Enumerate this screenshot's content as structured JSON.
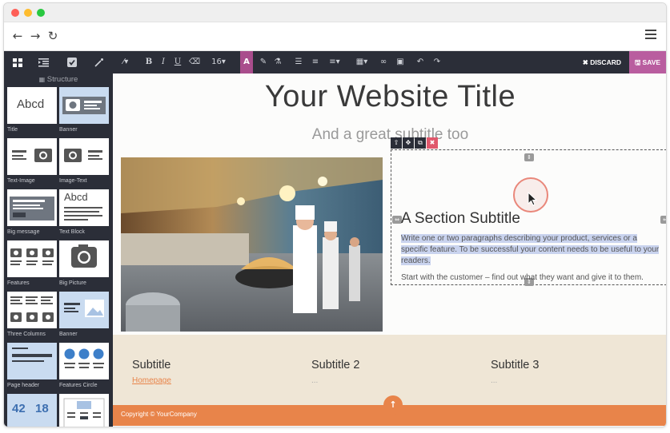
{
  "browser": {
    "dots": [
      "#fe5f57",
      "#febc2e",
      "#28c840"
    ],
    "back_icon": "←",
    "forward_icon": "→",
    "reload_icon": "↻"
  },
  "toolbar": {
    "left_icons": [
      "grid-icon",
      "indent-icon",
      "checkbox-icon",
      "magic-wand-icon"
    ],
    "tools": {
      "wand": "⁄▾",
      "bold": "B",
      "italic": "I",
      "underline": "U",
      "eraser": "⌫",
      "font_size": "16▾",
      "font_color": "A",
      "brush": "✎",
      "lab": "⚗",
      "bullet_list": "☰",
      "numbered_list": "≡",
      "align": "≡▾",
      "table": "▦▾",
      "link": "∞",
      "image": "▣",
      "undo": "↶",
      "redo": "↷"
    },
    "discard_label": "✖ DISCARD",
    "save_label": "🖫 SAVE",
    "accent": "#b95d9f"
  },
  "sidebar": {
    "header": "Structure",
    "snippets": [
      {
        "label": "Title"
      },
      {
        "label": "Banner"
      },
      {
        "label": "Text-Image"
      },
      {
        "label": "Image-Text"
      },
      {
        "label": "Big message"
      },
      {
        "label": "Text Block"
      },
      {
        "label": "Features"
      },
      {
        "label": "Big Picture"
      },
      {
        "label": "Three Columns"
      },
      {
        "label": "Banner"
      },
      {
        "label": "Page header"
      },
      {
        "label": "Features Circle"
      },
      {
        "label": ""
      },
      {
        "label": ""
      }
    ],
    "thumb_text_title": "Abcd",
    "thumb_text_block": "Abcd",
    "stat_a": "42",
    "stat_b": "18"
  },
  "page": {
    "title": "Your Website Title",
    "subtitle": "And a great subtitle too",
    "section_title": "A Section Subtitle",
    "section_para": "Write one or two paragraphs describing your product, services or a specific feature. To be successful your content needs to be useful to your readers.",
    "section_para2": "Start with the customer – find out what they want and give it to them.",
    "footer_cols": [
      {
        "title": "Subtitle",
        "link": "Homepage"
      },
      {
        "title": "Subtitle 2",
        "link": "..."
      },
      {
        "title": "Subtitle 3",
        "link": "..."
      }
    ],
    "copyright": "Copyright © YourCompany",
    "scroll_top": "↑",
    "accent_orange": "#e8844a"
  }
}
